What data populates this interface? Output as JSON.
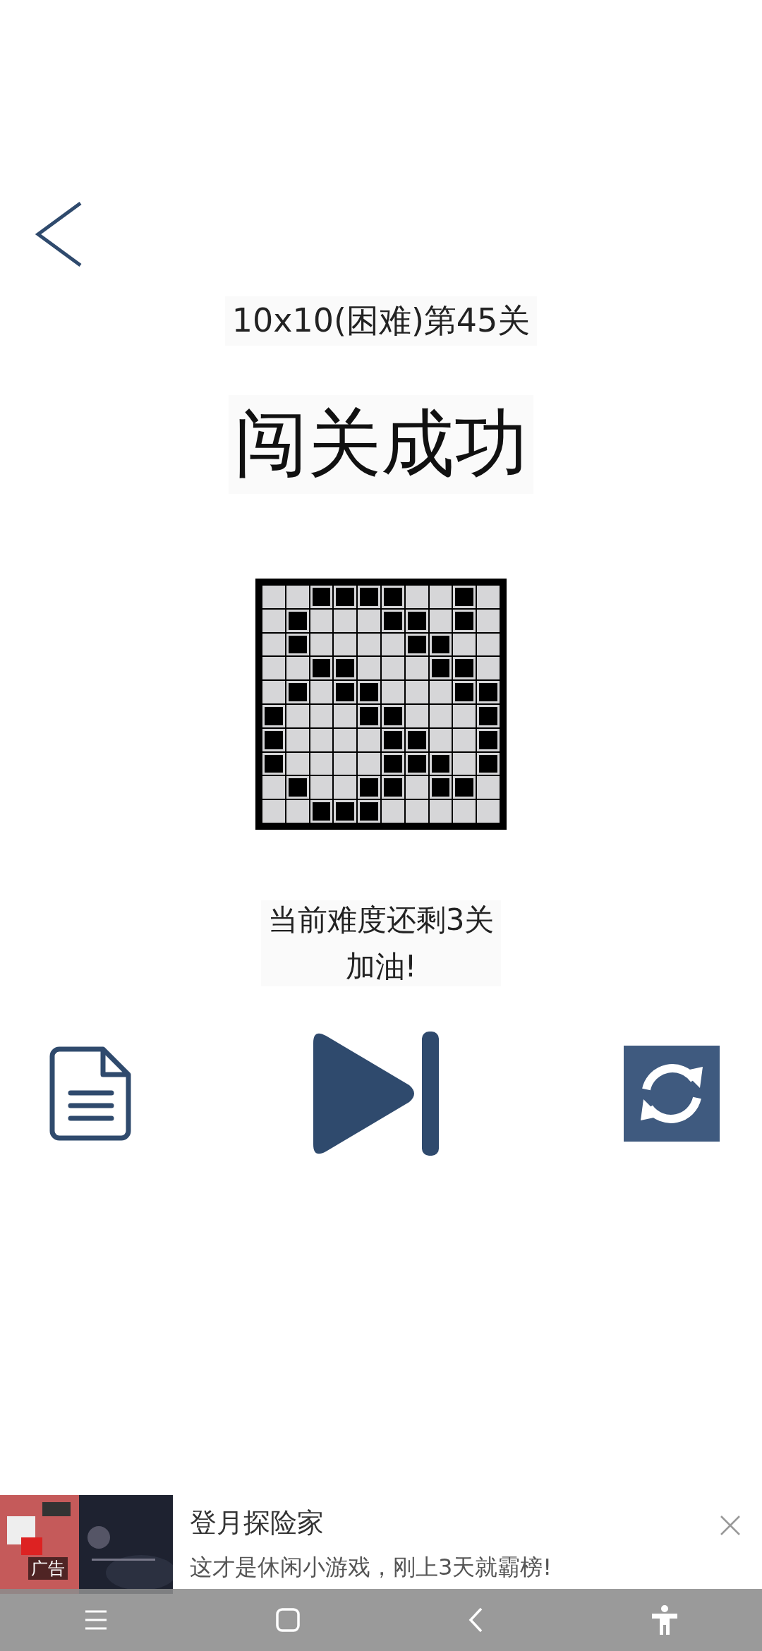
{
  "level_title": "10x10(困难)第45关",
  "result": "闯关成功",
  "grid": {
    "rows": [
      [
        false,
        false,
        true,
        true,
        true,
        true,
        false,
        false,
        true,
        false
      ],
      [
        false,
        true,
        false,
        false,
        false,
        true,
        true,
        false,
        true,
        false
      ],
      [
        false,
        true,
        false,
        false,
        false,
        false,
        true,
        true,
        false,
        false
      ],
      [
        false,
        false,
        true,
        true,
        false,
        false,
        false,
        true,
        true,
        false
      ],
      [
        false,
        true,
        false,
        true,
        true,
        false,
        false,
        false,
        true,
        true
      ],
      [
        true,
        false,
        false,
        false,
        true,
        true,
        false,
        false,
        false,
        true
      ],
      [
        true,
        false,
        false,
        false,
        false,
        true,
        true,
        false,
        false,
        true
      ],
      [
        true,
        false,
        false,
        false,
        false,
        true,
        true,
        true,
        false,
        true
      ],
      [
        false,
        true,
        false,
        false,
        true,
        true,
        false,
        true,
        true,
        false
      ],
      [
        false,
        false,
        true,
        true,
        true,
        false,
        false,
        false,
        false,
        false
      ]
    ]
  },
  "message": [
    "当前难度还剩3关",
    "加油!"
  ],
  "ad": {
    "label": "广告",
    "title": "登月探险家",
    "text": "这才是休闲小游戏，刚上3天就霸榜!"
  }
}
